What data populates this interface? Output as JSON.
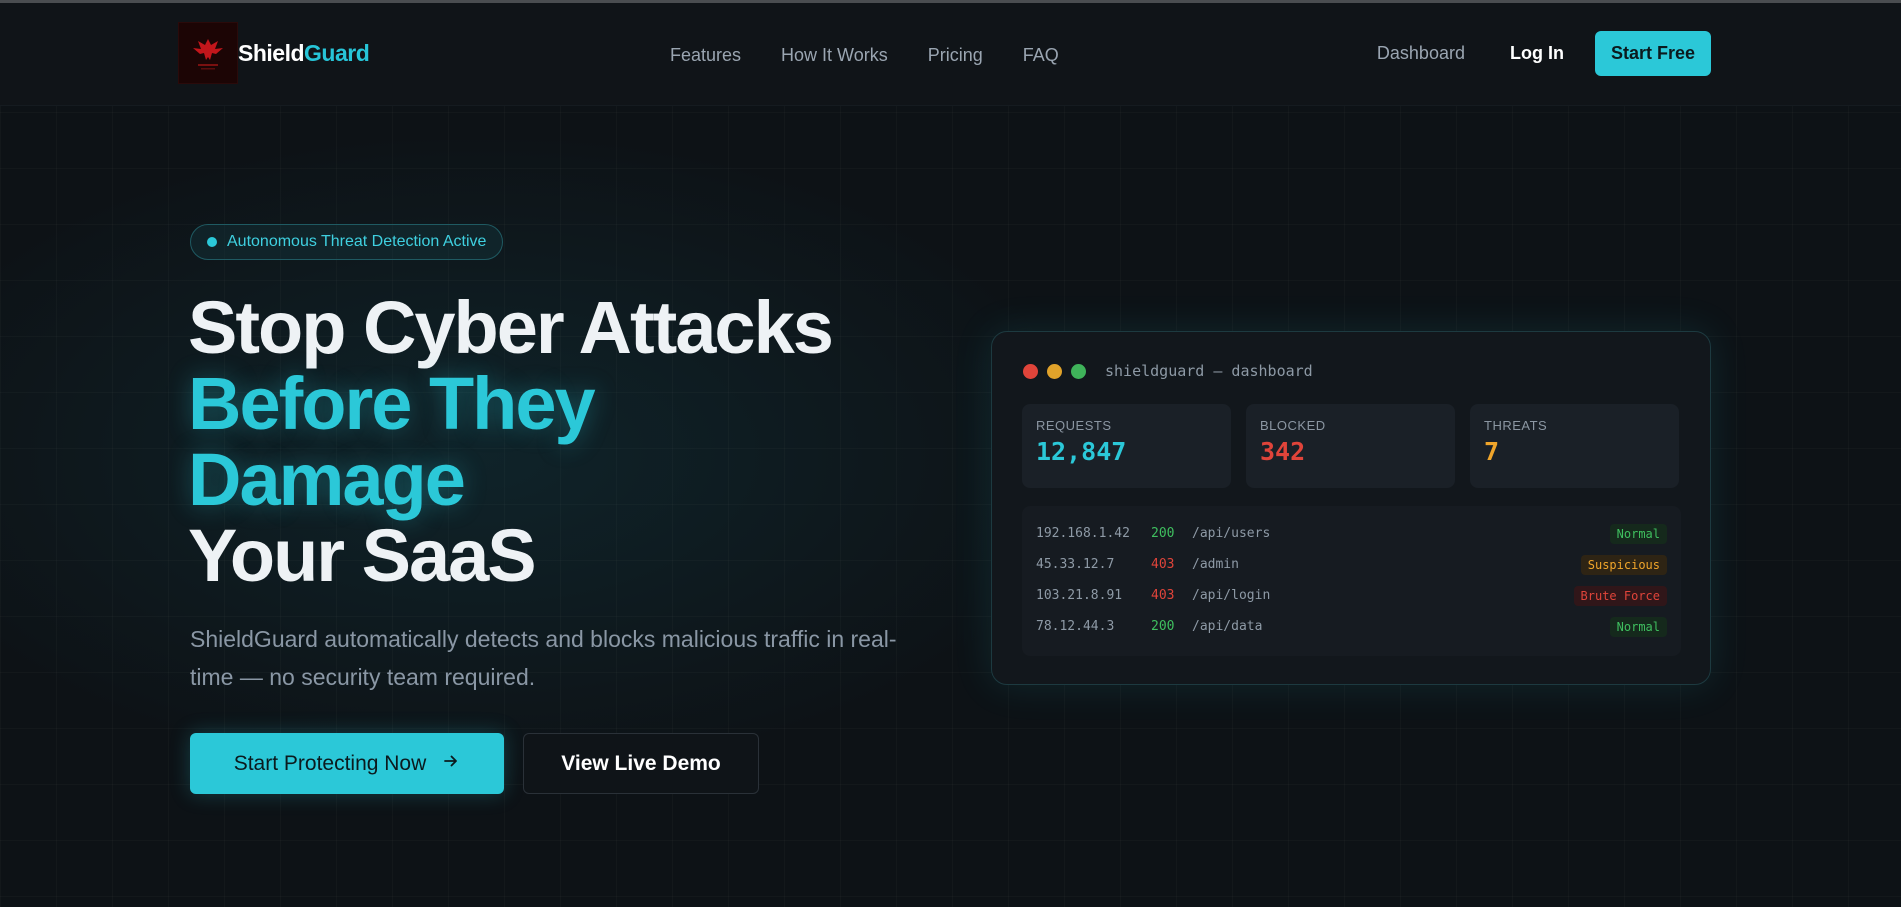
{
  "nav": {
    "brand_first": "Shield",
    "brand_second": "Guard",
    "links": [
      "Features",
      "How It Works",
      "Pricing",
      "FAQ"
    ],
    "dashboard": "Dashboard",
    "login": "Log In",
    "cta": "Start Free"
  },
  "hero": {
    "badge": "Autonomous Threat Detection Active",
    "headline_1": "Stop Cyber Attacks",
    "headline_2": "Before They",
    "headline_3": "Damage",
    "headline_4": "Your SaaS",
    "subtitle": "ShieldGuard automatically detects and blocks malicious traffic in real-time — no security team required.",
    "primary_button": "Start Protecting Now",
    "secondary_button": "View Live Demo"
  },
  "dashboard": {
    "title": "shieldguard — dashboard",
    "stats": [
      {
        "label": "REQUESTS",
        "value": "12,847",
        "color": "#2bc8d8"
      },
      {
        "label": "BLOCKED",
        "value": "342",
        "color": "#e0443a"
      },
      {
        "label": "THREATS",
        "value": "7",
        "color": "#f0a52a"
      }
    ],
    "logs": [
      {
        "ip": "192.168.1.42",
        "code": "200",
        "path": "/api/users",
        "tag": "Normal",
        "code_color": "#3fbf5f",
        "tag_color": "#3fbf5f",
        "tag_bg": "#15291c"
      },
      {
        "ip": "45.33.12.7",
        "code": "403",
        "path": "/admin",
        "tag": "Suspicious",
        "code_color": "#e0443a",
        "tag_color": "#f0a52a",
        "tag_bg": "#2e2414"
      },
      {
        "ip": "103.21.8.91",
        "code": "403",
        "path": "/api/login",
        "tag": "Brute Force",
        "code_color": "#e0443a",
        "tag_color": "#e0443a",
        "tag_bg": "#301619"
      },
      {
        "ip": "78.12.44.3",
        "code": "200",
        "path": "/api/data",
        "tag": "Normal",
        "code_color": "#3fbf5f",
        "tag_color": "#3fbf5f",
        "tag_bg": "#15291c"
      }
    ]
  },
  "colors": {
    "accent": "#2bc8d8",
    "background": "#0d1216",
    "danger": "#e0443a",
    "warning": "#f0a52a",
    "success": "#3fbf5f"
  },
  "icons": {
    "logo": "phoenix-logo-icon",
    "arrow": "arrow-right-icon"
  }
}
